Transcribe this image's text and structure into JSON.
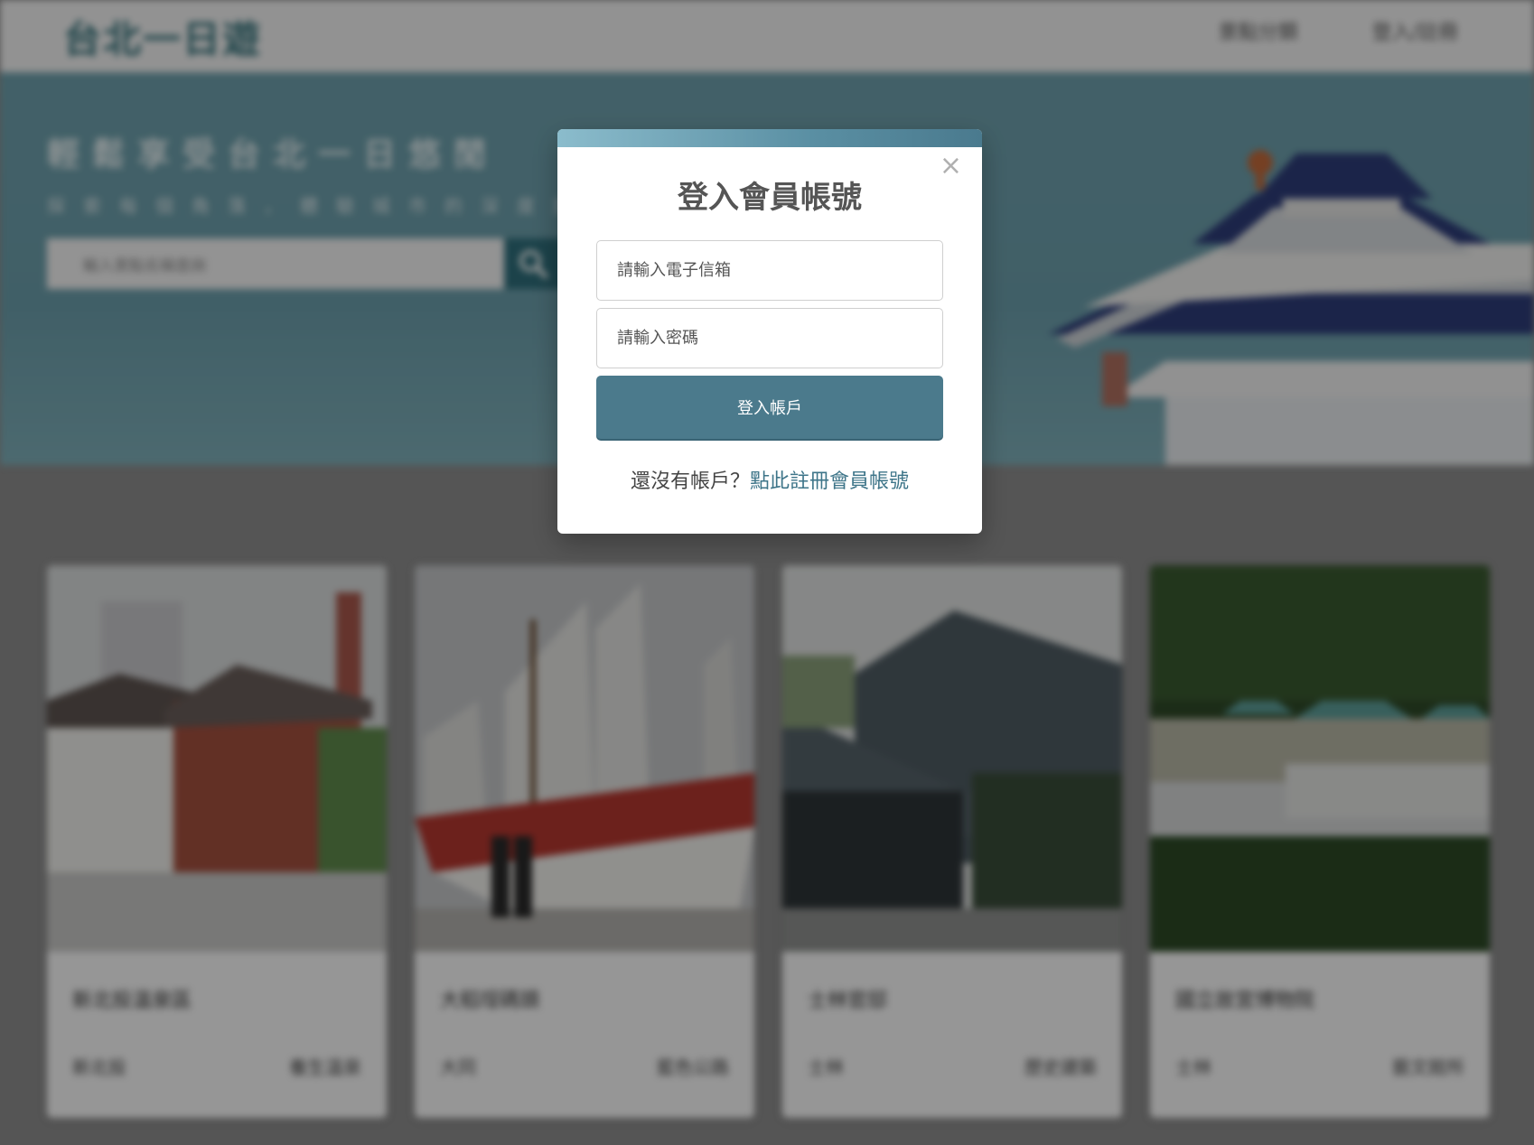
{
  "navbar": {
    "logo": "台北一日遊",
    "links": [
      "景點分類",
      "登入/註冊"
    ]
  },
  "hero": {
    "title": "輕鬆享受台北一日悠閒",
    "subtitle": "探索每個角落，體驗城市的深度旅遊行程",
    "search_placeholder": "輸入景點名稱查詢"
  },
  "cards": [
    {
      "name": "新北投溫泉區",
      "district": "新北投",
      "category": "養生溫泉"
    },
    {
      "name": "大稻埕碼頭",
      "district": "大同",
      "category": "藍色公路"
    },
    {
      "name": "士林官邸",
      "district": "士林",
      "category": "歷史建築"
    },
    {
      "name": "國立故宮博物院",
      "district": "士林",
      "category": "藝文館所"
    }
  ],
  "modal": {
    "title": "登入會員帳號",
    "close": "×",
    "email_placeholder": "請輸入電子信箱",
    "password_placeholder": "請輸入密碼",
    "login_button": "登入帳戶",
    "register_prompt": "還沒有帳戶？",
    "register_link": "點此註冊會員帳號"
  },
  "colors": {
    "primary": "#4b7a8c",
    "accent_link": "#3e7589",
    "hero_bg": "#6fa1ad"
  }
}
